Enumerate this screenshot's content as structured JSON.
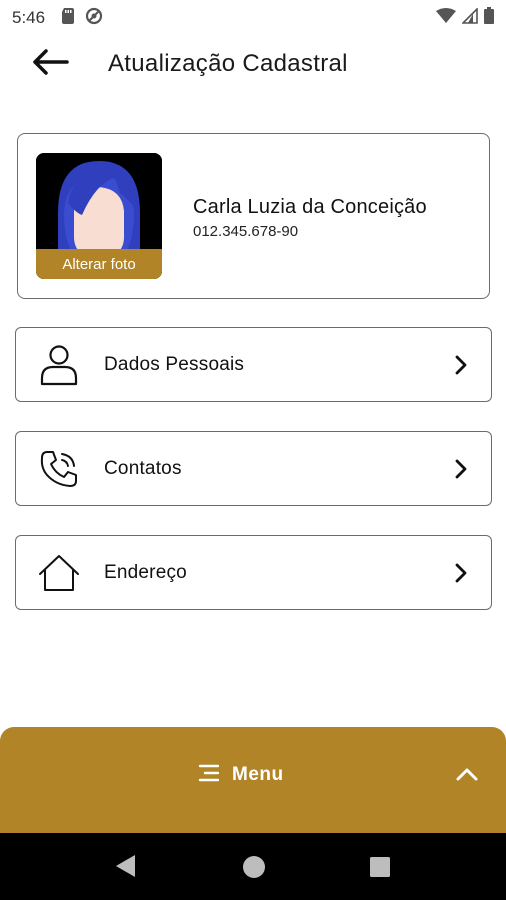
{
  "status_bar": {
    "time": "5:46",
    "left_icons": [
      "sd-card-icon",
      "data-saver-icon"
    ],
    "right_icons": [
      "wifi-icon",
      "signal-icon",
      "battery-icon"
    ]
  },
  "header": {
    "title": "Atualização Cadastral",
    "back_icon": "arrow-left-icon"
  },
  "profile": {
    "name": "Carla Luzia da Conceição",
    "id": "012.345.678-90",
    "change_photo_label": "Alterar foto"
  },
  "menu_items": [
    {
      "label": "Dados Pessoais",
      "icon": "person-icon"
    },
    {
      "label": "Contatos",
      "icon": "phone-icon"
    },
    {
      "label": "Endereço",
      "icon": "home-icon"
    }
  ],
  "bottom_bar": {
    "label": "Menu",
    "icon": "menu-lines-icon",
    "expand_icon": "chevron-up-icon"
  },
  "colors": {
    "accent": "#b08427",
    "border": "#6b6b6b",
    "text": "#111111"
  }
}
